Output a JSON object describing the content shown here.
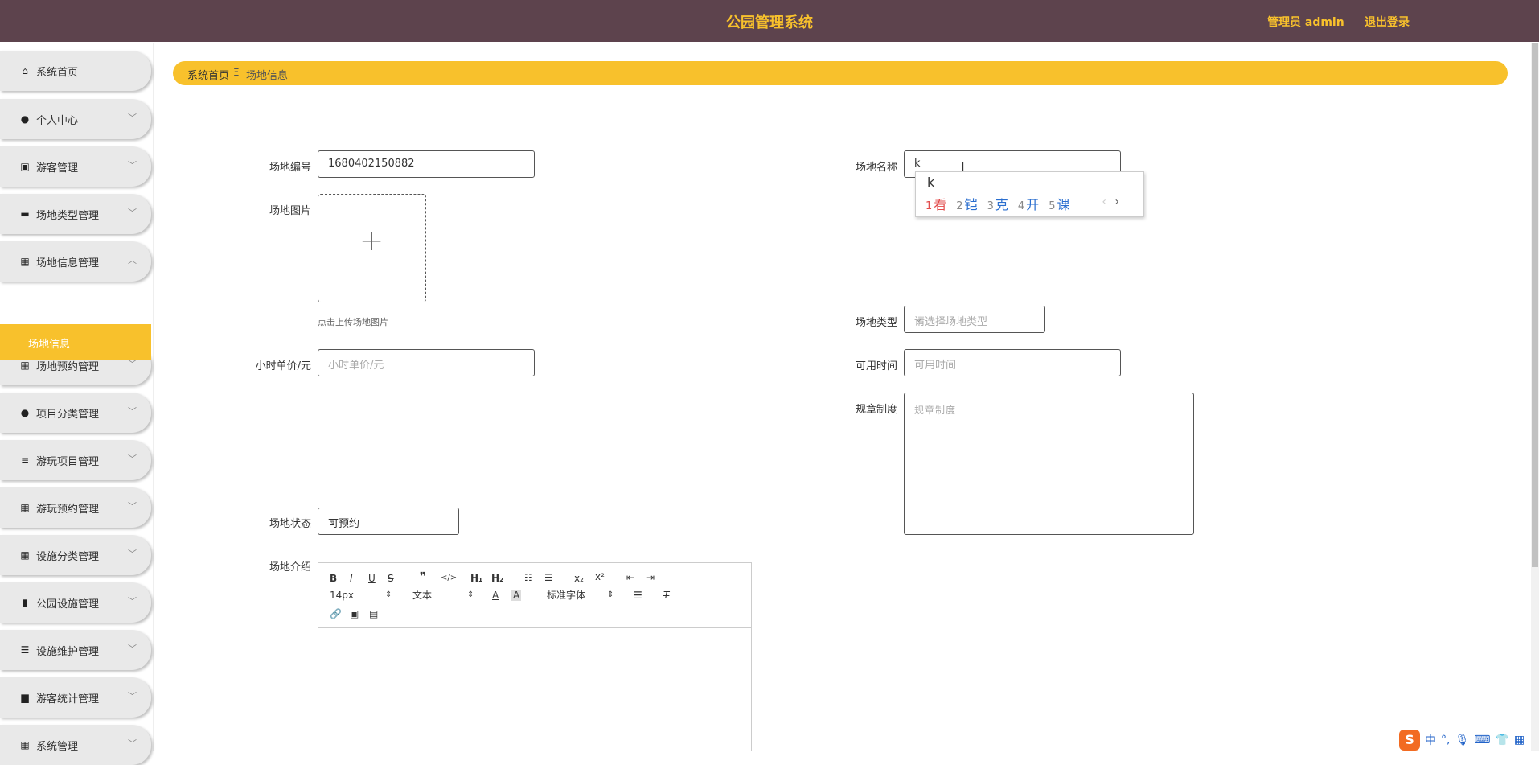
{
  "header": {
    "title": "公园管理系统",
    "admin_label": "管理员 admin",
    "logout_label": "退出登录"
  },
  "sidebar": {
    "items": [
      {
        "label": "系统首页",
        "icon": "home-icon",
        "glyph": "⌂",
        "has_chevron": false
      },
      {
        "label": "个人中心",
        "icon": "user-icon",
        "glyph": "●",
        "has_chevron": true
      },
      {
        "label": "游客管理",
        "icon": "clipboard-icon",
        "glyph": "▣",
        "has_chevron": true
      },
      {
        "label": "场地类型管理",
        "icon": "monitor-icon",
        "glyph": "▬",
        "has_chevron": true
      },
      {
        "label": "场地信息管理",
        "icon": "grid-icon",
        "glyph": "▦",
        "has_chevron": true,
        "expanded": true
      },
      {
        "label": "场地预约管理",
        "icon": "grid-icon",
        "glyph": "▦",
        "has_chevron": true
      },
      {
        "label": "项目分类管理",
        "icon": "user-icon",
        "glyph": "●",
        "has_chevron": true
      },
      {
        "label": "游玩项目管理",
        "icon": "list-icon",
        "glyph": "≡",
        "has_chevron": true
      },
      {
        "label": "游玩预约管理",
        "icon": "grid-icon",
        "glyph": "▦",
        "has_chevron": true
      },
      {
        "label": "设施分类管理",
        "icon": "grid-icon",
        "glyph": "▦",
        "has_chevron": true
      },
      {
        "label": "公园设施管理",
        "icon": "bar-chart-icon",
        "glyph": "▮",
        "has_chevron": true
      },
      {
        "label": "设施维护管理",
        "icon": "sliders-icon",
        "glyph": "☰",
        "has_chevron": true
      },
      {
        "label": "游客统计管理",
        "icon": "briefcase-icon",
        "glyph": "▆",
        "has_chevron": true
      },
      {
        "label": "系统管理",
        "icon": "grid-icon",
        "glyph": "▦",
        "has_chevron": true
      }
    ],
    "active_sub": "场地信息"
  },
  "breadcrumb": {
    "home": "系统首页",
    "separator": "Ξ",
    "current": "场地信息"
  },
  "form": {
    "venue_no": {
      "label": "场地编号",
      "value": "1680402150882"
    },
    "venue_name": {
      "label": "场地名称",
      "value": "k"
    },
    "venue_image": {
      "label": "场地图片",
      "hint": "点击上传场地图片"
    },
    "venue_type": {
      "label": "场地类型",
      "placeholder": "请选择场地类型"
    },
    "hourly_price": {
      "label": "小时单价/元",
      "placeholder": "小时单价/元"
    },
    "available_time": {
      "label": "可用时间",
      "placeholder": "可用时间"
    },
    "rules": {
      "label": "规章制度",
      "placeholder": "规章制度"
    },
    "status": {
      "label": "场地状态",
      "value": "可预约"
    },
    "intro": {
      "label": "场地介绍"
    }
  },
  "editor_toolbar": {
    "font_size": "14px",
    "text_style": "文本",
    "font_family": "标准字体"
  },
  "ime": {
    "composition": "k",
    "candidates": [
      {
        "n": "1",
        "w": "看"
      },
      {
        "n": "2",
        "w": "铠"
      },
      {
        "n": "3",
        "w": "克"
      },
      {
        "n": "4",
        "w": "开"
      },
      {
        "n": "5",
        "w": "课"
      }
    ],
    "next": "›",
    "prev": "‹"
  },
  "tray": {
    "logo": "S",
    "lang": "中"
  },
  "colors": {
    "header_bg": "#5d434d",
    "accent": "#f8c12c",
    "sidebar_item_bg": "#e9e9e9"
  }
}
